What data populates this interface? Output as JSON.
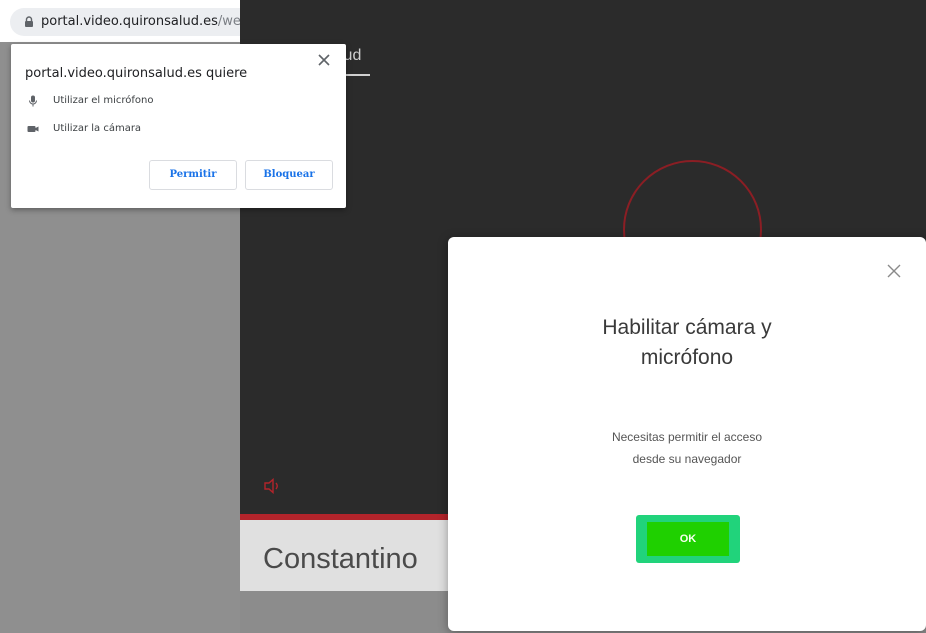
{
  "browser": {
    "url_host": "portal.video.quironsalud.es",
    "url_path": "/webapp/home"
  },
  "permission_popup": {
    "title": "portal.video.quironsalud.es quiere",
    "items": [
      {
        "icon": "microphone-icon",
        "label": "Utilizar el micrófono"
      },
      {
        "icon": "camera-icon",
        "label": "Utilizar la cámara"
      }
    ],
    "allow_label": "Permitir",
    "block_label": "Bloquear"
  },
  "background_app": {
    "brand_fragment": "lud",
    "caller_name": "Constantino",
    "accent_color": "#b3242b"
  },
  "modal": {
    "title_line1": "Habilitar cámara y",
    "title_line2": "micrófono",
    "body_line1": "Necesitas permitir el acceso",
    "body_line2": "desde su navegador",
    "ok_label": "OK",
    "ok_color": "#21d37b"
  }
}
